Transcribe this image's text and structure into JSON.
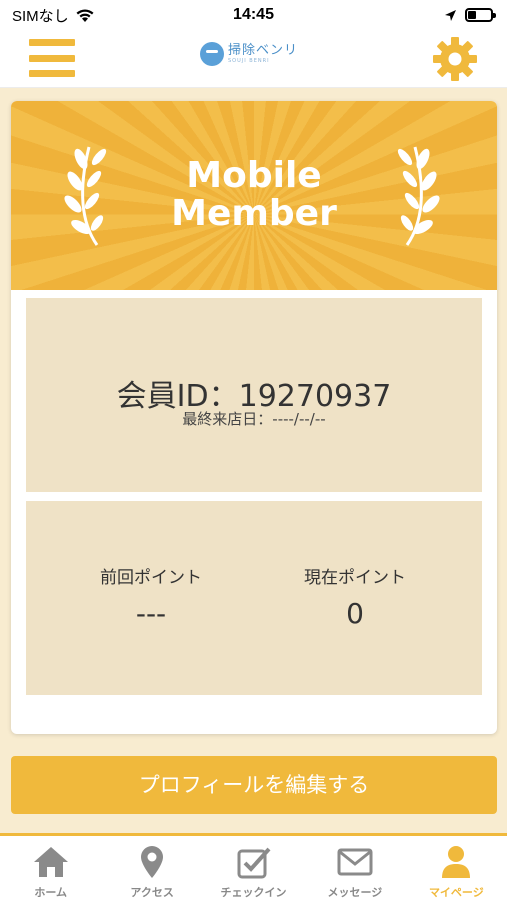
{
  "status_bar": {
    "carrier": "SIMなし",
    "time": "14:45",
    "battery_level": 0.35,
    "icons": [
      "wifi-icon",
      "location-arrow-icon",
      "battery-icon"
    ]
  },
  "header": {
    "logo_text": "掃除ベンリ",
    "logo_subtext": "SOUJI BENRI",
    "icons": [
      "menu-icon",
      "gear-icon"
    ]
  },
  "card": {
    "banner_title_line1": "Mobile",
    "banner_title_line2": "Member",
    "member_id": "会員ID：19270937",
    "last_visit": "最終来店日：----/--/--",
    "previous_points_label": "前回ポイント",
    "previous_points_value": "---",
    "current_points_label": "現在ポイント",
    "current_points_value": "0"
  },
  "edit_button_label": "プロフィールを編集する",
  "tabs": [
    {
      "label": "ホーム",
      "icon": "home-icon",
      "active": false
    },
    {
      "label": "アクセス",
      "icon": "map-pin-icon",
      "active": false
    },
    {
      "label": "チェックイン",
      "icon": "checkin-icon",
      "active": false
    },
    {
      "label": "メッセージ",
      "icon": "mail-icon",
      "active": false
    },
    {
      "label": "マイページ",
      "icon": "user-icon",
      "active": true
    }
  ],
  "colors": {
    "accent": "#f0b93c",
    "panel": "#efe2c6",
    "background": "#f8ecd0",
    "tab_inactive": "#888888"
  }
}
